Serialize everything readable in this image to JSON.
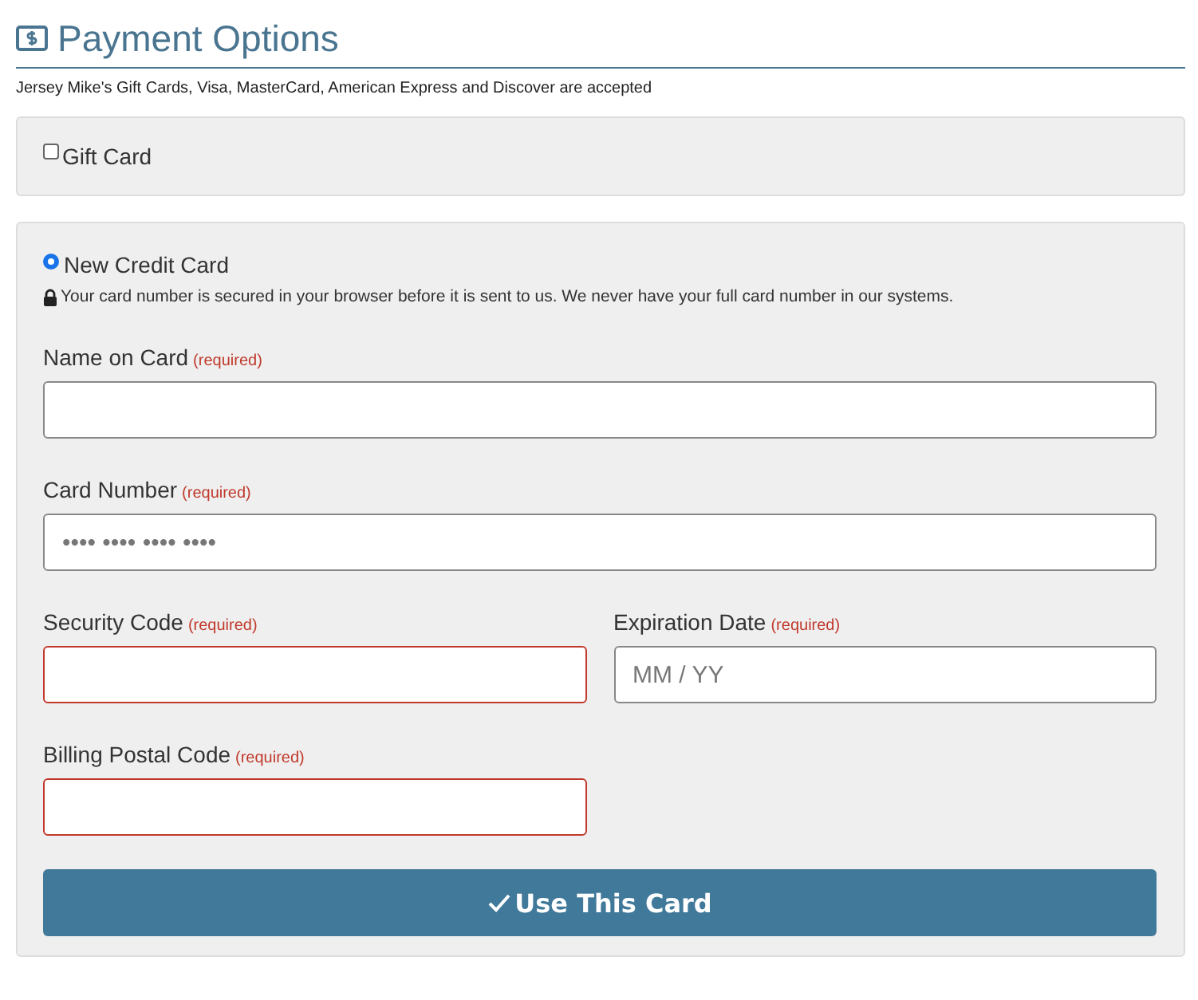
{
  "header": {
    "title": "Payment Options",
    "subtitle": "Jersey Mike's Gift Cards, Visa, MasterCard, American Express and Discover are accepted"
  },
  "gift_card": {
    "label": "Gift Card",
    "checked": false
  },
  "credit_card": {
    "label": "New Credit Card",
    "selected": true,
    "note": "Your card number is secured in your browser before it is sent to us. We never have your full card number in our systems.",
    "rows": [
      {
        "fields": [
          {
            "label": "Name on Card",
            "required": "(required)",
            "invalid": false
          }
        ],
        "half": false
      },
      {
        "fields": [
          {
            "label": "Card Number",
            "required": "(required)",
            "placeholder": "•••• •••• •••• ••••",
            "invalid": false
          }
        ],
        "half": false
      },
      {
        "fields": [
          {
            "label": "Security Code",
            "required": "(required)",
            "invalid": true
          },
          {
            "label": "Expiration Date",
            "required": "(required)",
            "placeholder": "MM / YY",
            "invalid": false
          }
        ],
        "half": false
      },
      {
        "fields": [
          {
            "label": "Billing Postal Code",
            "required": "(required)",
            "invalid": true
          }
        ],
        "half": true
      }
    ],
    "button": "Use This Card"
  }
}
